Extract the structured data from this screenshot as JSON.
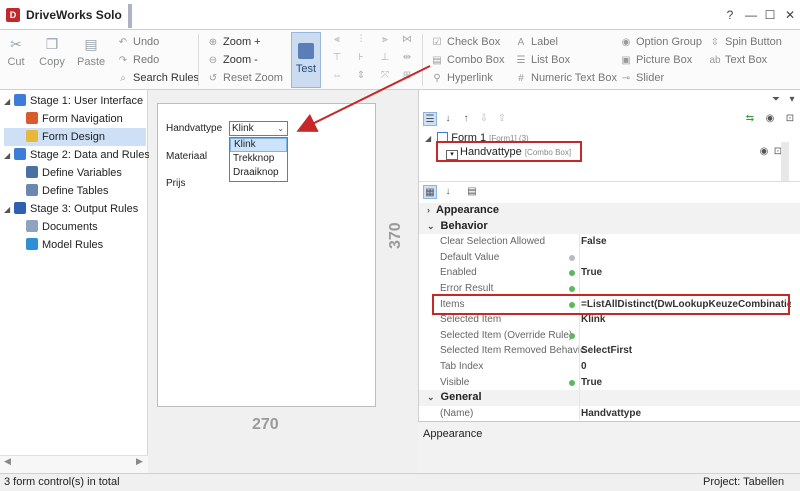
{
  "window": {
    "title": "DriveWorks Solo",
    "controls": [
      "?",
      "—",
      "☐",
      "✕"
    ]
  },
  "ribbon": {
    "clipboard": [
      {
        "label": "Cut",
        "icon": "scissors-icon"
      },
      {
        "label": "Copy",
        "icon": "copy-icon"
      },
      {
        "label": "Paste",
        "icon": "paste-icon"
      }
    ],
    "undo_label": "Undo",
    "redo_label": "Redo",
    "search_label": "Search Rules",
    "zoom_in_label": "Zoom +",
    "zoom_out_label": "Zoom -",
    "reset_zoom_label": "Reset Zoom",
    "test_label": "Test",
    "controls_col1": [
      "Check Box",
      "Combo Box",
      "Hyperlink"
    ],
    "controls_col2": [
      "Label",
      "List Box",
      "Numeric Text Box"
    ],
    "controls_col3": [
      "Option Group",
      "Picture Box",
      "Slider"
    ],
    "controls_col4": [
      "Spin Button",
      "Text Box"
    ]
  },
  "nav": {
    "items": [
      {
        "label": "Stage 1: User Interface",
        "level": 0
      },
      {
        "label": "Form Navigation",
        "level": 1
      },
      {
        "label": "Form Design",
        "level": 1,
        "selected": true
      },
      {
        "label": "Stage 2: Data and Rules",
        "level": 0
      },
      {
        "label": "Define Variables",
        "level": 1
      },
      {
        "label": "Define Tables",
        "level": 1
      },
      {
        "label": "Stage 3: Output Rules",
        "level": 0
      },
      {
        "label": "Documents",
        "level": 1
      },
      {
        "label": "Model Rules",
        "level": 1
      }
    ]
  },
  "form": {
    "labels": [
      "Handvattype",
      "Materiaal",
      "Prijs"
    ],
    "combo_value": "Klink",
    "dropdown_options": [
      "Klink",
      "Trekknop",
      "Draaiknop"
    ],
    "width": "270",
    "height": "370"
  },
  "tree": {
    "form_label": "Form 1",
    "form_tag": "[Form1] (3)",
    "control_label": "Handvattype",
    "control_tag": "[Combo Box]"
  },
  "properties": {
    "cat_appearance": "Appearance",
    "cat_behavior": "Behavior",
    "rows": [
      {
        "name": "Clear Selection Allowed",
        "value": "False",
        "dot": ""
      },
      {
        "name": "Default Value",
        "value": "",
        "dot": "grey"
      },
      {
        "name": "Enabled",
        "value": "True",
        "dot": "green"
      },
      {
        "name": "Error Result",
        "value": "",
        "dot": "green"
      },
      {
        "name": "Items",
        "value": "=ListAllDistinct(DwLookupKeuzeCombinatie",
        "dot": "green"
      },
      {
        "name": "Selected Item",
        "value": "Klink",
        "dot": ""
      },
      {
        "name": "Selected Item (Override Rule)",
        "value": "",
        "dot": "green"
      },
      {
        "name": "Selected Item Removed Behavic",
        "value": "SelectFirst",
        "dot": ""
      },
      {
        "name": "Tab Index",
        "value": "0",
        "dot": ""
      },
      {
        "name": "Visible",
        "value": "True",
        "dot": "green"
      }
    ],
    "cat_general": "General",
    "general_rows": [
      {
        "name": "(Name)",
        "value": "Handvattype",
        "dot": ""
      }
    ],
    "description_title": "Appearance"
  },
  "status": {
    "left": "3 form control(s) in total",
    "right": "Project: Tabellen"
  },
  "colors": {
    "accent": "#cde0f5",
    "annotation_red": "#c62828",
    "true_dot": "#5cb85c"
  }
}
